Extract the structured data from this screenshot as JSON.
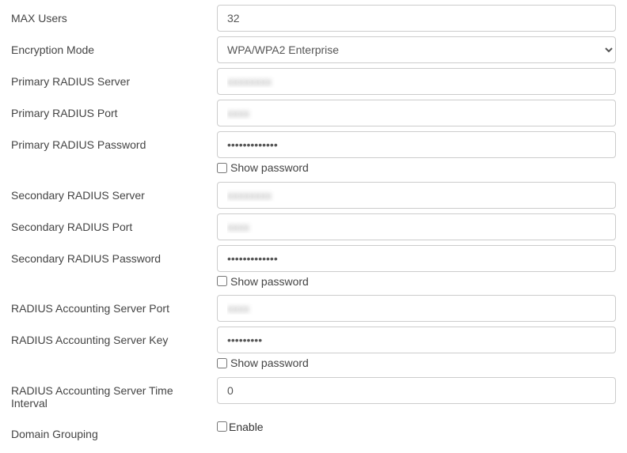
{
  "fields": {
    "max_users": {
      "label": "MAX Users",
      "value": "32"
    },
    "encryption_mode": {
      "label": "Encryption Mode",
      "value": "WPA/WPA2 Enterprise"
    },
    "primary_radius_server": {
      "label": "Primary RADIUS Server",
      "value": "xxxxxxxx"
    },
    "primary_radius_port": {
      "label": "Primary RADIUS Port",
      "value": "xxxx"
    },
    "primary_radius_password": {
      "label": "Primary RADIUS Password",
      "value": "•••••••••••••",
      "show_label": "Show password"
    },
    "secondary_radius_server": {
      "label": "Secondary RADIUS Server",
      "value": "xxxxxxxx"
    },
    "secondary_radius_port": {
      "label": "Secondary RADIUS Port",
      "value": "xxxx"
    },
    "secondary_radius_password": {
      "label": "Secondary RADIUS Password",
      "value": "•••••••••••••",
      "show_label": "Show password"
    },
    "radius_acct_port": {
      "label": "RADIUS Accounting Server Port",
      "value": "xxxx"
    },
    "radius_acct_key": {
      "label": "RADIUS Accounting Server Key",
      "value": "•••••••••",
      "show_label": "Show password"
    },
    "radius_acct_interval": {
      "label": "RADIUS Accounting Server Time Interval",
      "value": "0"
    },
    "domain_grouping": {
      "label": "Domain Grouping",
      "checkbox_label": "Enable"
    }
  }
}
